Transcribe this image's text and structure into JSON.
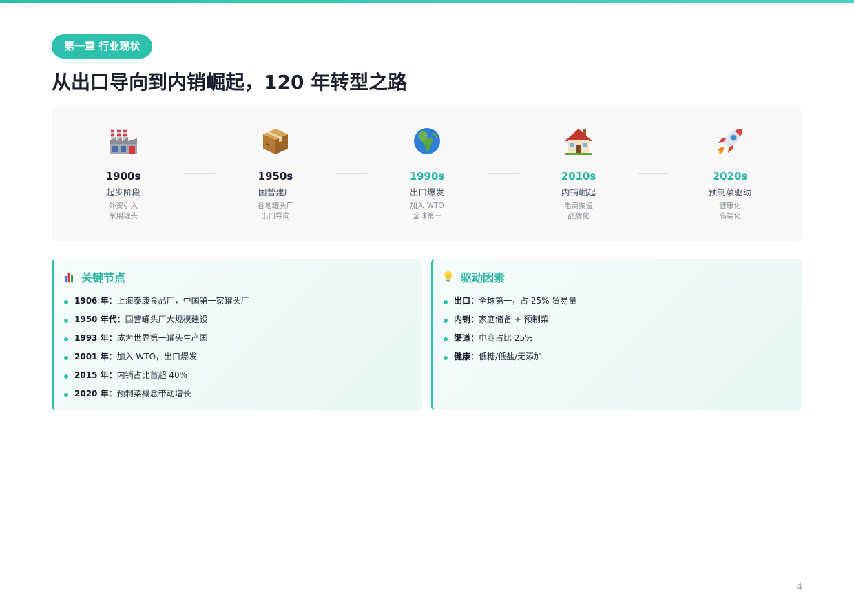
{
  "chapter_badge": "第一章 行业现状",
  "title": "从出口导向到内销崛起，120 年转型之路",
  "timeline": [
    {
      "icon": "factory-icon",
      "year": "1900s",
      "stage": "起步阶段",
      "detail_1": "外资引入",
      "detail_2": "军用罐头",
      "accent": false
    },
    {
      "icon": "package-icon",
      "year": "1950s",
      "stage": "国营建厂",
      "detail_1": "各地罐头厂",
      "detail_2": "出口导向",
      "accent": false
    },
    {
      "icon": "globe-icon",
      "year": "1990s",
      "stage": "出口爆发",
      "detail_1": "加入 WTO",
      "detail_2": "全球第一",
      "accent": true
    },
    {
      "icon": "house-icon",
      "year": "2010s",
      "stage": "内销崛起",
      "detail_1": "电商渠道",
      "detail_2": "品牌化",
      "accent": true
    },
    {
      "icon": "rocket-icon",
      "year": "2020s",
      "stage": "预制菜驱动",
      "detail_1": "健康化",
      "detail_2": "高端化",
      "accent": true
    }
  ],
  "key_nodes": {
    "icon": "bar-chart-icon",
    "title": "关键节点",
    "items": [
      {
        "key": "1906 年：",
        "text": "上海泰康食品厂，中国第一家罐头厂"
      },
      {
        "key": "1950 年代：",
        "text": "国营罐头厂大规模建设"
      },
      {
        "key": "1993 年：",
        "text": "成为世界第一罐头生产国"
      },
      {
        "key": "2001 年：",
        "text": "加入 WTO，出口爆发"
      },
      {
        "key": "2015 年：",
        "text": "内销占比首超 40%"
      },
      {
        "key": "2020 年：",
        "text": "预制菜概念带动增长"
      }
    ]
  },
  "drivers": {
    "icon": "lightbulb-icon",
    "title": "驱动因素",
    "items": [
      {
        "key": "出口：",
        "text": "全球第一，占 25% 贸易量"
      },
      {
        "key": "内销：",
        "text": "家庭储备 + 预制菜"
      },
      {
        "key": "渠道：",
        "text": "电商占比 25%"
      },
      {
        "key": "健康：",
        "text": "低糖/低盐/无添加"
      }
    ]
  },
  "page_number": "4",
  "colors": {
    "accent": "#2cc0ad",
    "title": "#1a1f2e",
    "panel": "#f8f8f8"
  }
}
